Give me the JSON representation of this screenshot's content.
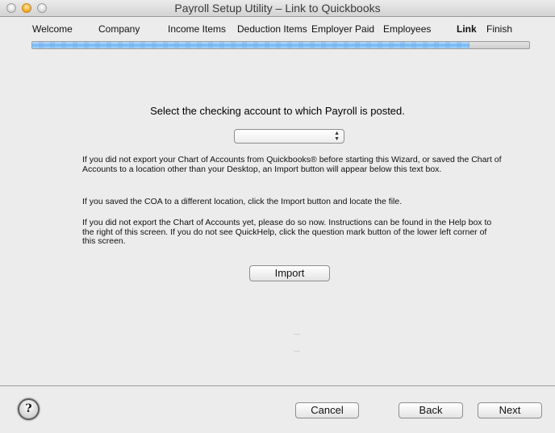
{
  "window": {
    "title": "Payroll Setup Utility – Link to Quickbooks",
    "controls": [
      "close",
      "minimize",
      "zoom"
    ]
  },
  "steps": [
    {
      "label": "Welcome",
      "active": false
    },
    {
      "label": "Company",
      "active": false
    },
    {
      "label": "Income Items",
      "active": false
    },
    {
      "label": "Deduction Items",
      "active": false
    },
    {
      "label": "Employer Paid",
      "active": false
    },
    {
      "label": "Employees",
      "active": false
    },
    {
      "label": "Link",
      "active": true
    },
    {
      "label": "Finish",
      "active": false
    }
  ],
  "progress": {
    "percent": 88
  },
  "main": {
    "prompt": "Select the checking account to which Payroll is posted.",
    "account_select": {
      "value": "",
      "arrows_icon": "▴▾"
    },
    "paragraphs": [
      "If you did not export your Chart of Accounts from Quickbooks® before starting this Wizard, or saved the Chart of Accounts to a location other than your Desktop, an Import button will appear below this text box.",
      "If you saved the COA to a different location, click the Import button and locate the file.",
      "If you did not export the Chart of Accounts yet, please do so now. Instructions can be found in the Help box to the right of this screen. If you do not see QuickHelp, click the question mark button of the lower left corner of this screen."
    ],
    "import_label": "Import"
  },
  "footer": {
    "help_label": "?",
    "cancel_label": "Cancel",
    "back_label": "Back",
    "next_label": "Next"
  }
}
